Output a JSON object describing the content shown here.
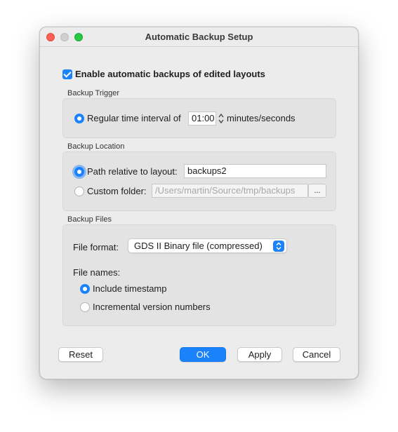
{
  "window": {
    "title": "Automatic Backup Setup"
  },
  "enable_backups": {
    "label": "Enable automatic backups of edited layouts",
    "checked": true
  },
  "trigger": {
    "section_label": "Backup Trigger",
    "option_label": "Regular time interval of",
    "interval_value": "01:00",
    "unit_label": "minutes/seconds"
  },
  "location": {
    "section_label": "Backup Location",
    "relative_label": "Path relative to layout:",
    "relative_value": "backups2",
    "custom_label": "Custom folder:",
    "custom_value": "/Users/martin/Source/tmp/backups",
    "browse_label": "..."
  },
  "files": {
    "section_label": "Backup Files",
    "format_label": "File format:",
    "format_value": "GDS II Binary file (compressed)",
    "names_label": "File names:",
    "timestamp_label": "Include timestamp",
    "incremental_label": "Incremental version numbers"
  },
  "buttons": {
    "reset": "Reset",
    "ok": "OK",
    "apply": "Apply",
    "cancel": "Cancel"
  },
  "colors": {
    "accent": "#1a82fb",
    "window_bg": "#ececec",
    "group_bg": "#e3e3e3"
  }
}
